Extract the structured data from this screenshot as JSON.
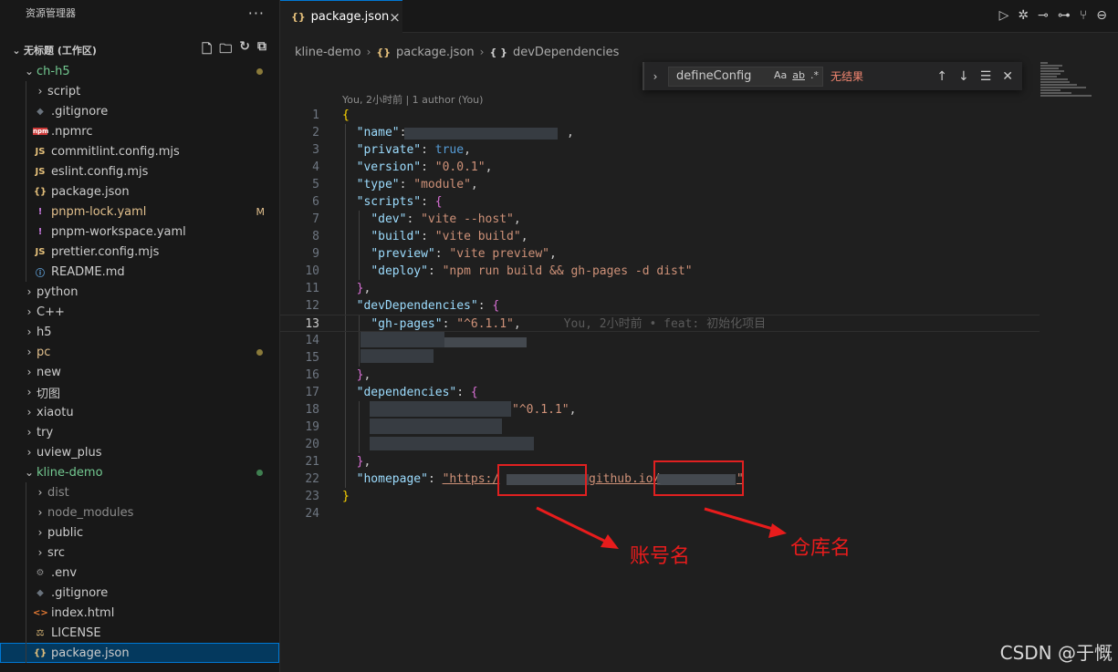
{
  "explorer": {
    "title": "资源管理器",
    "more": "···",
    "workspace": "无标题 (工作区)"
  },
  "tree": [
    {
      "label": "ch-h5",
      "depth": 1,
      "type": "folder-open",
      "color": "#73c991",
      "dot": "#8a7a3a"
    },
    {
      "label": "script",
      "depth": 2,
      "type": "folder"
    },
    {
      "label": ".gitignore",
      "depth": 2,
      "type": "file",
      "icon": "◆",
      "iconColor": "#6a737d"
    },
    {
      "label": ".npmrc",
      "depth": 2,
      "type": "file",
      "icon": "npm",
      "iconColor": "#cb3837"
    },
    {
      "label": "commitlint.config.mjs",
      "depth": 2,
      "type": "file",
      "icon": "JS",
      "iconColor": "#e5c07b"
    },
    {
      "label": "eslint.config.mjs",
      "depth": 2,
      "type": "file",
      "icon": "JS",
      "iconColor": "#e5c07b"
    },
    {
      "label": "package.json",
      "depth": 2,
      "type": "file",
      "icon": "{}",
      "iconColor": "#e5c07b"
    },
    {
      "label": "pnpm-lock.yaml",
      "depth": 2,
      "type": "file",
      "icon": "!",
      "iconColor": "#c678dd",
      "color": "#e2c08d",
      "badge": "M",
      "badgeColor": "#e2c08d"
    },
    {
      "label": "pnpm-workspace.yaml",
      "depth": 2,
      "type": "file",
      "icon": "!",
      "iconColor": "#c678dd"
    },
    {
      "label": "prettier.config.mjs",
      "depth": 2,
      "type": "file",
      "icon": "JS",
      "iconColor": "#e5c07b"
    },
    {
      "label": "README.md",
      "depth": 2,
      "type": "file",
      "icon": "ⓘ",
      "iconColor": "#5fa0d8"
    },
    {
      "label": "python",
      "depth": 1,
      "type": "folder"
    },
    {
      "label": "C++",
      "depth": 1,
      "type": "folder"
    },
    {
      "label": "h5",
      "depth": 1,
      "type": "folder"
    },
    {
      "label": "pc",
      "depth": 1,
      "type": "folder",
      "color": "#e2c08d",
      "dot": "#8a7a3a"
    },
    {
      "label": "new",
      "depth": 1,
      "type": "folder"
    },
    {
      "label": "切图",
      "depth": 1,
      "type": "folder"
    },
    {
      "label": "xiaotu",
      "depth": 1,
      "type": "folder"
    },
    {
      "label": "try",
      "depth": 1,
      "type": "folder"
    },
    {
      "label": "uview_plus",
      "depth": 1,
      "type": "folder"
    },
    {
      "label": "kline-demo",
      "depth": 1,
      "type": "folder-open",
      "color": "#73c991",
      "dot": "#3f7f50"
    },
    {
      "label": "dist",
      "depth": 2,
      "type": "folder",
      "color": "#8c8c8c"
    },
    {
      "label": "node_modules",
      "depth": 2,
      "type": "folder",
      "color": "#8c8c8c"
    },
    {
      "label": "public",
      "depth": 2,
      "type": "folder"
    },
    {
      "label": "src",
      "depth": 2,
      "type": "folder"
    },
    {
      "label": ".env",
      "depth": 2,
      "type": "file",
      "icon": "⚙",
      "iconColor": "#8c8c8c"
    },
    {
      "label": ".gitignore",
      "depth": 2,
      "type": "file",
      "icon": "◆",
      "iconColor": "#6a737d",
      "color": "#cccccc"
    },
    {
      "label": "index.html",
      "depth": 2,
      "type": "file",
      "icon": "<>",
      "iconColor": "#e37933"
    },
    {
      "label": "LICENSE",
      "depth": 2,
      "type": "file",
      "icon": "⚖",
      "iconColor": "#e5c07b"
    },
    {
      "label": "package.json",
      "depth": 2,
      "type": "file",
      "icon": "{}",
      "iconColor": "#e5c07b",
      "active": true
    }
  ],
  "tab": {
    "icon": "{}",
    "label": "package.json",
    "close": "×"
  },
  "breadcrumb": {
    "folder": "kline-demo",
    "file": "package.json",
    "symbol": "devDependencies"
  },
  "find": {
    "query": "defineConfig",
    "opt1": "Aa",
    "opt2": "ab",
    "opt3": ".*",
    "result": "无结果"
  },
  "editor": {
    "blame_header": "You, 2小时前 | 1 author (You)",
    "inline_blame": "You, 2小时前 • feat: 初始化项目",
    "lines": [
      "1",
      "2",
      "3",
      "4",
      "5",
      "6",
      "7",
      "8",
      "9",
      "10",
      "11",
      "12",
      "13",
      "14",
      "15",
      "16",
      "17",
      "18",
      "19",
      "20",
      "21",
      "22",
      "23",
      "24"
    ],
    "current_line": "13",
    "keys": {
      "name": "\"name\"",
      "private": "\"private\"",
      "version": "\"version\"",
      "type": "\"type\"",
      "scripts": "\"scripts\"",
      "dev": "\"dev\"",
      "build": "\"build\"",
      "preview": "\"preview\"",
      "deploy": "\"deploy\"",
      "devDependencies": "\"devDependencies\"",
      "gh_pages": "\"gh-pages\"",
      "dependencies": "\"dependencies\"",
      "homepage": "\"homepage\""
    },
    "values": {
      "true": "true",
      "version": "\"0.0.1\"",
      "type": "\"module\"",
      "dev": "\"vite --host\"",
      "build": "\"vite build\"",
      "preview": "\"vite preview\"",
      "deploy": "\"npm run build && gh-pages -d dist\"",
      "gh_pages": "\"^6.1.1\"",
      "dep_version": "\"^0.1.1\"",
      "homepage_a": "\"https:/",
      "homepage_b": "github.io/",
      "homepage_c": "\""
    }
  },
  "annotations": {
    "account": "账号名",
    "repo": "仓库名"
  },
  "watermark": "CSDN @于慨"
}
